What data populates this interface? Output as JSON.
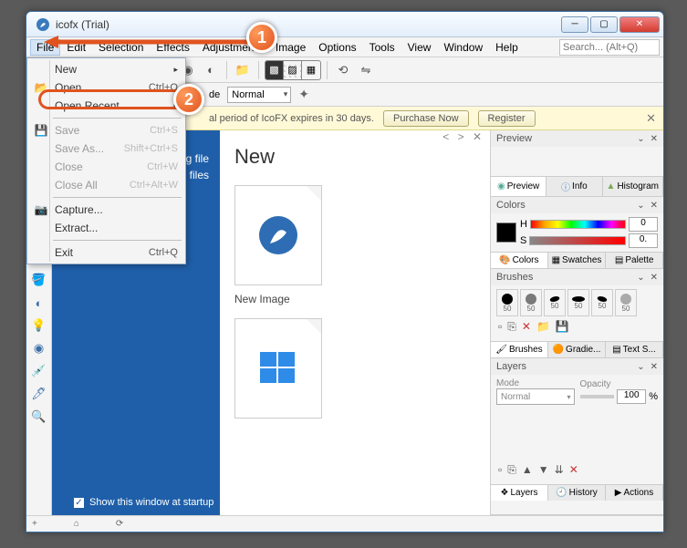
{
  "window": {
    "title": "icofx (Trial)"
  },
  "menu": {
    "items": [
      "File",
      "Edit",
      "Selection",
      "Effects",
      "Adjustments",
      "Image",
      "Options",
      "Tools",
      "View",
      "Window",
      "Help"
    ],
    "search_placeholder": "Search... (Alt+Q)"
  },
  "file_menu": [
    {
      "label": "New",
      "shortcut": "",
      "icon": "",
      "sub": true,
      "enabled": true
    },
    {
      "label": "Open...",
      "shortcut": "Ctrl+O",
      "icon": "folder",
      "enabled": true,
      "hl": true
    },
    {
      "label": "Open Recent",
      "shortcut": "",
      "icon": "",
      "sub": true,
      "enabled": true
    },
    {
      "sep": true
    },
    {
      "label": "Save",
      "shortcut": "Ctrl+S",
      "icon": "disk",
      "enabled": false
    },
    {
      "label": "Save As...",
      "shortcut": "Shift+Ctrl+S",
      "icon": "",
      "enabled": false
    },
    {
      "label": "Close",
      "shortcut": "Ctrl+W",
      "icon": "",
      "enabled": false
    },
    {
      "label": "Close All",
      "shortcut": "Ctrl+Alt+W",
      "icon": "",
      "enabled": false
    },
    {
      "sep": true
    },
    {
      "label": "Capture...",
      "shortcut": "",
      "icon": "camera",
      "enabled": true
    },
    {
      "label": "Extract...",
      "shortcut": "",
      "icon": "",
      "enabled": true
    },
    {
      "sep": true
    },
    {
      "label": "Exit",
      "shortcut": "Ctrl+Q",
      "icon": "",
      "enabled": true
    }
  ],
  "optbar": {
    "mode_label": "de",
    "mode_value": "Normal"
  },
  "trial": {
    "text": "al period of IcoFX expires in 30 days.",
    "purchase": "Purchase Now",
    "register": "Register"
  },
  "start": {
    "heading": "New",
    "nav_items": [
      "ng file",
      "rom files"
    ],
    "thumb1": "New Image",
    "show": "Show this window at startup",
    "tabs": [
      "<",
      ">",
      "✕"
    ]
  },
  "panels": {
    "preview": {
      "title": "Preview",
      "tabs": [
        "Preview",
        "Info",
        "Histogram"
      ]
    },
    "colors": {
      "title": "Colors",
      "h": "H",
      "s": "S",
      "hv": "0",
      "sv": "0.",
      "tabs": [
        "Colors",
        "Swatches",
        "Palette"
      ]
    },
    "brushes": {
      "title": "Brushes",
      "sizes": [
        "50",
        "50",
        "50",
        "50",
        "50",
        "50"
      ],
      "tabs": [
        "Brushes",
        "Gradie...",
        "Text S..."
      ]
    },
    "layers": {
      "title": "Layers",
      "mode_lbl": "Mode",
      "opacity_lbl": "Opacity",
      "mode": "Normal",
      "opacity": "100",
      "pct": "%",
      "tabs": [
        "Layers",
        "History",
        "Actions"
      ]
    }
  },
  "status": {
    "a": "+",
    "b": "⌂",
    "c": "⟳"
  },
  "callouts": {
    "c1": "1",
    "c2": "2"
  }
}
